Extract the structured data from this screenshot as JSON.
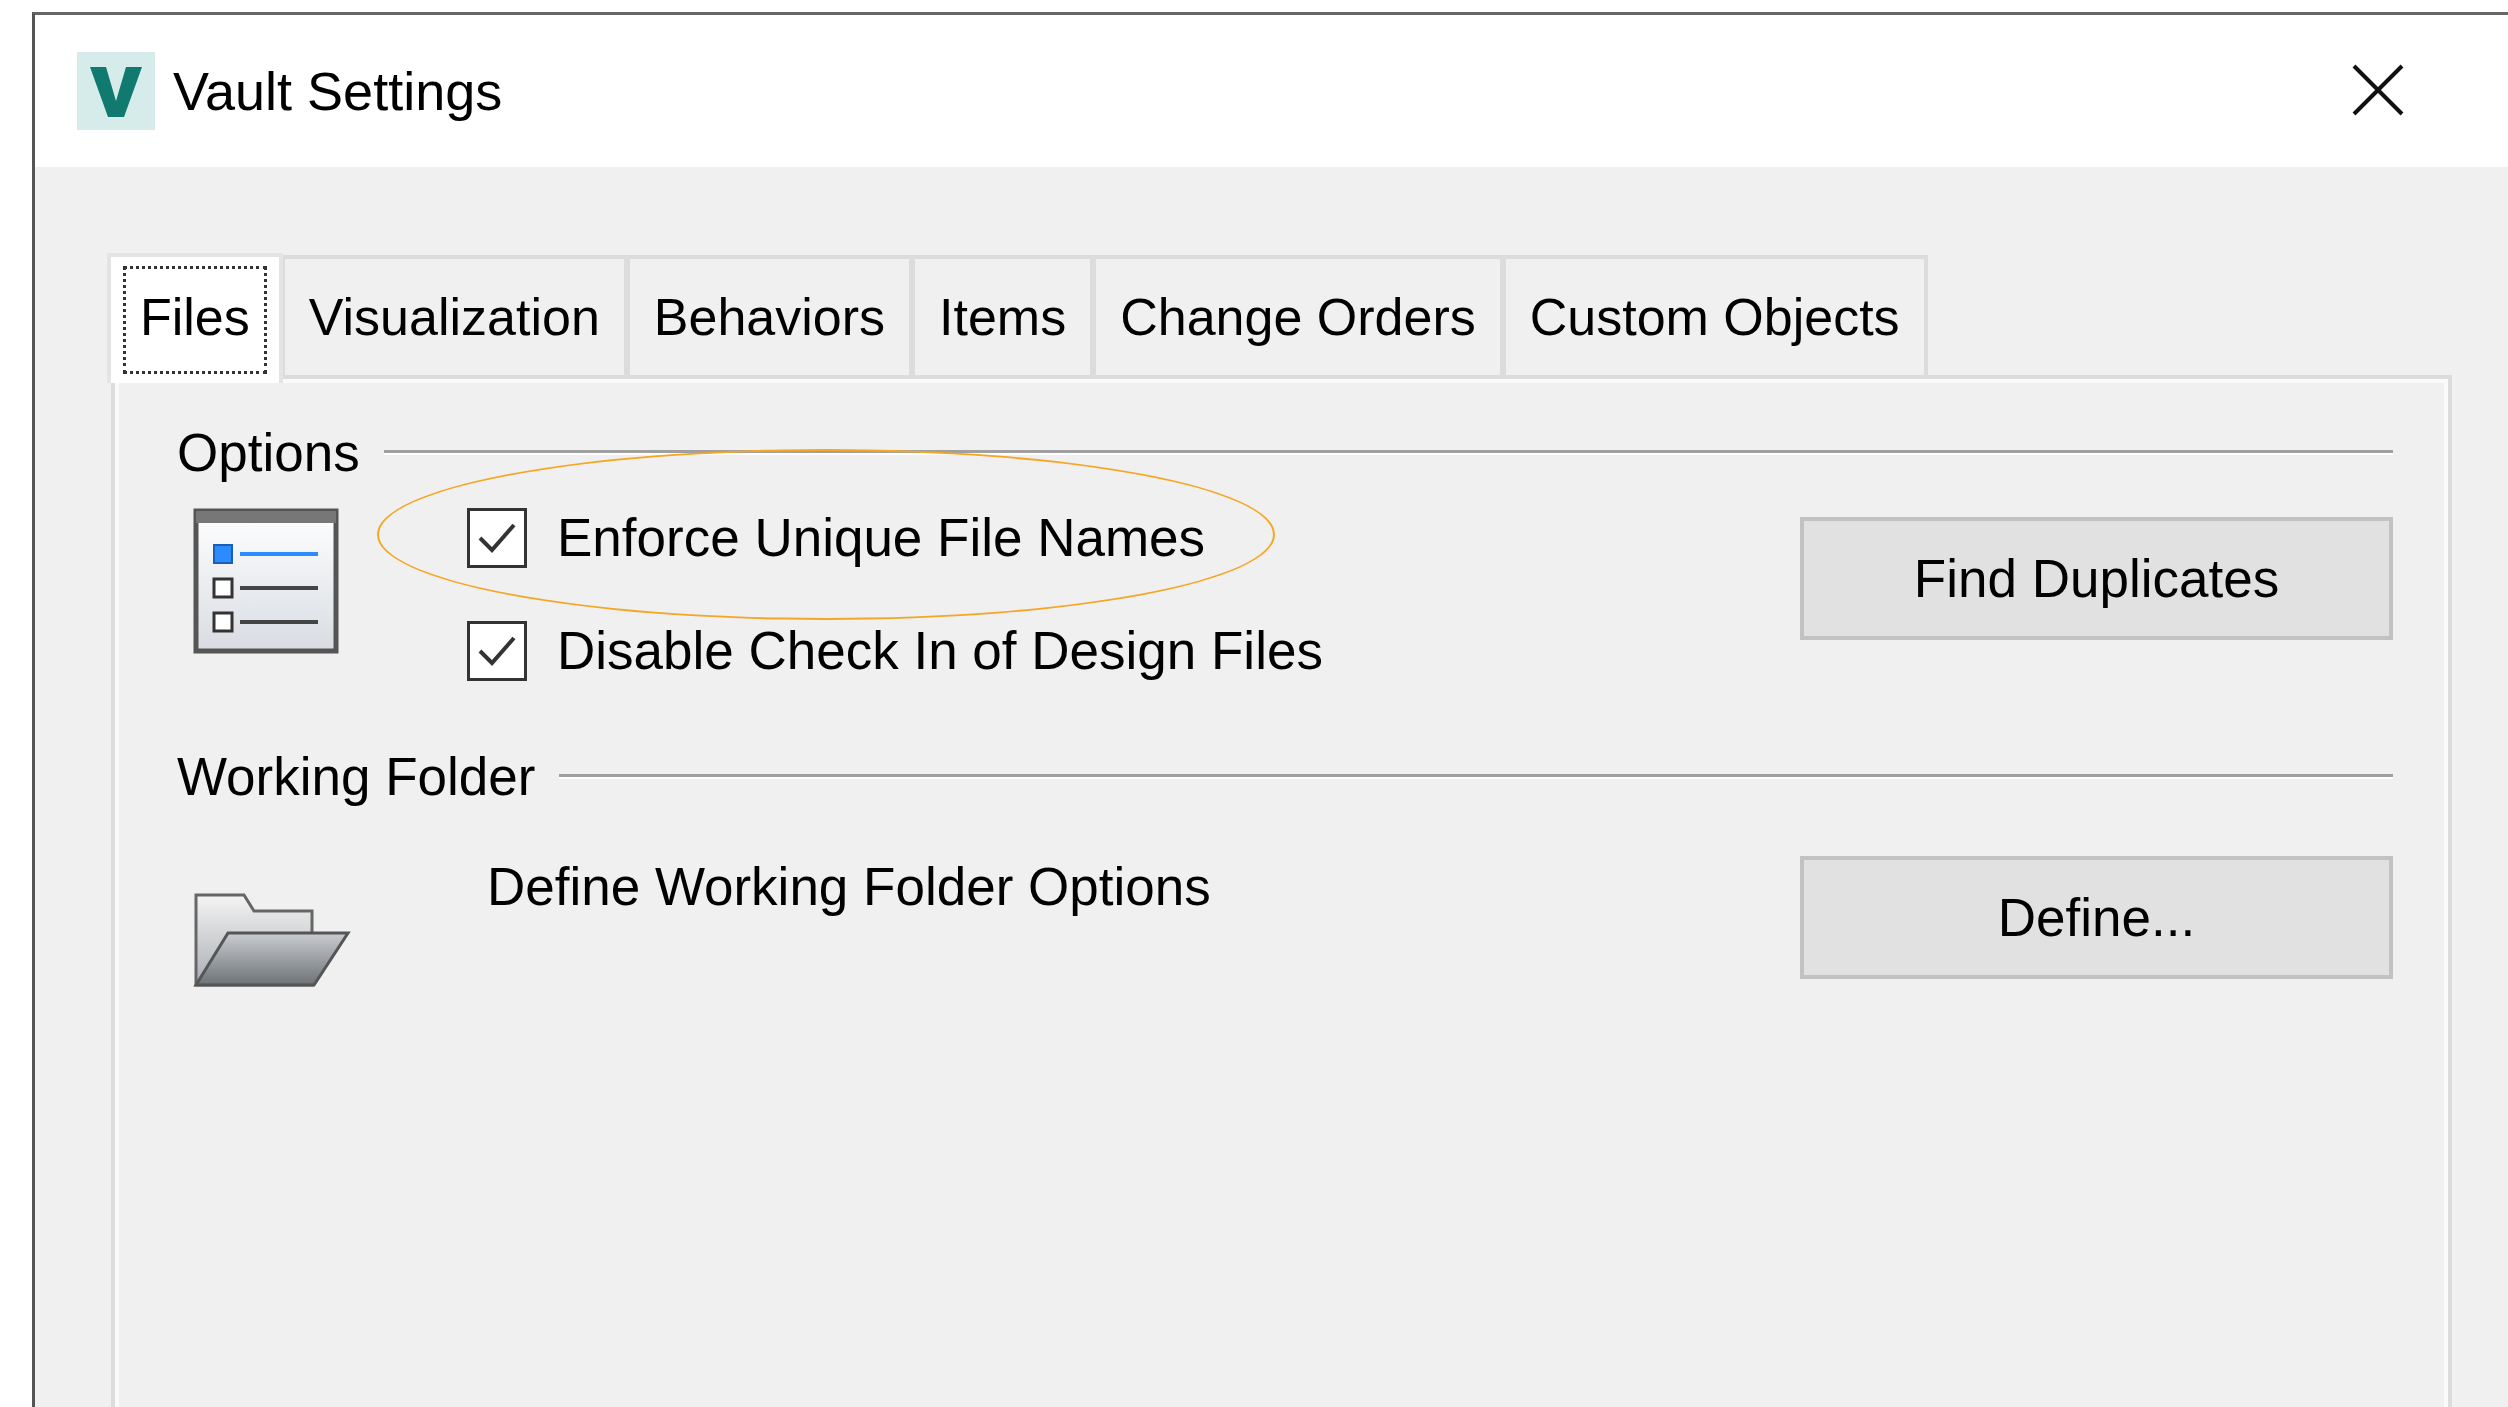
{
  "window": {
    "title": "Vault Settings"
  },
  "tabs": [
    {
      "label": "Files",
      "selected": true
    },
    {
      "label": "Visualization",
      "selected": false
    },
    {
      "label": "Behaviors",
      "selected": false
    },
    {
      "label": "Items",
      "selected": false
    },
    {
      "label": "Change Orders",
      "selected": false
    },
    {
      "label": "Custom Objects",
      "selected": false
    }
  ],
  "sections": [
    {
      "title": "Options",
      "kind": "options",
      "options": [
        {
          "label": "Enforce Unique File Names",
          "checked": true,
          "highlighted": true
        },
        {
          "label": "Disable Check In of Design Files",
          "checked": true,
          "highlighted": false
        }
      ],
      "button": "Find Duplicates"
    },
    {
      "title": "Working Folder",
      "kind": "folder",
      "description": "Define Working Folder Options",
      "button": "Define..."
    }
  ]
}
